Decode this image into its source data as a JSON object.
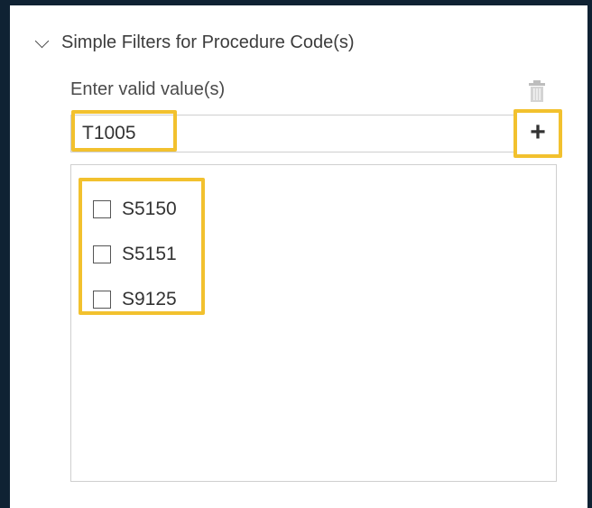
{
  "section": {
    "title": "Simple Filters for Procedure Code(s)",
    "expanded_icon": "chevron-down-icon"
  },
  "field": {
    "label": "Enter valid value(s)",
    "value": "T1005",
    "delete_icon": "trash-icon",
    "add_icon": "plus-icon",
    "add_label": "+"
  },
  "values_list": {
    "items": [
      {
        "label": "S5150",
        "checked": false
      },
      {
        "label": "S5151",
        "checked": false
      },
      {
        "label": "S9125",
        "checked": false
      }
    ]
  },
  "colors": {
    "highlight": "#f2c12e",
    "background": "#0f2233",
    "border": "#cfcfcf"
  }
}
